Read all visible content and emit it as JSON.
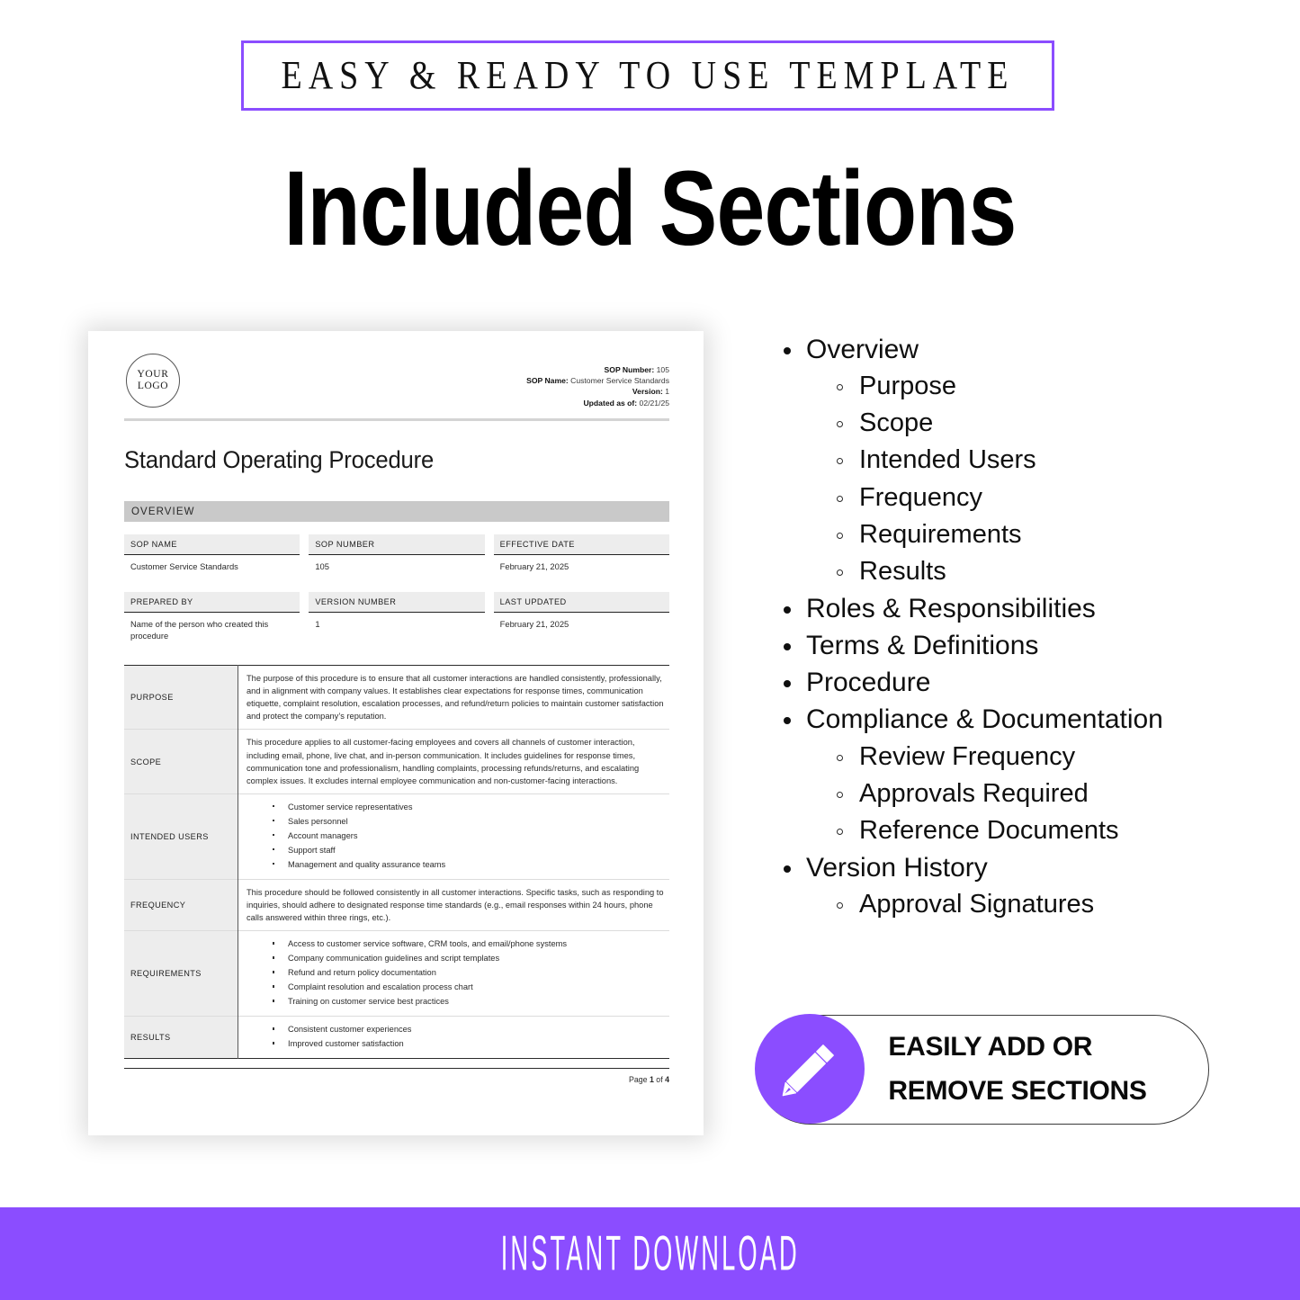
{
  "top_banner": {
    "text": "EASY & READY TO USE TEMPLATE"
  },
  "page_title": "Included Sections",
  "colors": {
    "accent_purple": "#8b4dff",
    "section_bar_gray": "#c9c9c9",
    "table_head_gray": "#ededed"
  },
  "document": {
    "logo": {
      "line1": "YOUR",
      "line2": "LOGO"
    },
    "meta": [
      {
        "label": "SOP Number:",
        "value": "105"
      },
      {
        "label": "SOP Name:",
        "value": "Customer Service Standards"
      },
      {
        "label": "Version:",
        "value": "1"
      },
      {
        "label": "Updated as of:",
        "value": "02/21/25"
      }
    ],
    "title": "Standard Operating Procedure",
    "section_bar": "OVERVIEW",
    "info_table_1": {
      "headers": [
        "SOP NAME",
        "SOP NUMBER",
        "EFFECTIVE DATE"
      ],
      "values": [
        "Customer Service Standards",
        "105",
        "February 21, 2025"
      ]
    },
    "info_table_2": {
      "headers": [
        "PREPARED BY",
        "VERSION NUMBER",
        "LAST UPDATED"
      ],
      "values": [
        "Name of the person who created this procedure",
        "1",
        "February 21, 2025"
      ]
    },
    "detail_rows": [
      {
        "label": "PURPOSE",
        "type": "paragraph",
        "text": "The purpose of this procedure is to ensure that all customer interactions are handled consistently, professionally, and in alignment with company values. It establishes clear expectations for response times, communication etiquette, complaint resolution, escalation processes, and refund/return policies to maintain customer satisfaction and protect the company’s reputation."
      },
      {
        "label": "SCOPE",
        "type": "paragraph",
        "text": "This procedure applies to all customer-facing employees and covers all channels of customer interaction, including email, phone, live chat, and in-person communication. It includes guidelines for response times, communication tone and professionalism, handling complaints, processing refunds/returns, and escalating complex issues. It excludes internal employee communication and non-customer-facing interactions."
      },
      {
        "label": "INTENDED USERS",
        "type": "list",
        "items": [
          "Customer service representatives",
          "Sales personnel",
          "Account managers",
          "Support staff",
          "Management and quality assurance teams"
        ]
      },
      {
        "label": "FREQUENCY",
        "type": "paragraph",
        "text": "This procedure should be followed consistently in all customer interactions. Specific tasks, such as responding to inquiries, should adhere to designated response time standards (e.g., email responses within 24 hours, phone calls answered within three rings, etc.)."
      },
      {
        "label": "REQUIREMENTS",
        "type": "list",
        "items": [
          "Access to customer service software, CRM tools, and email/phone systems",
          "Company communication guidelines and script templates",
          "Refund and return policy documentation",
          "Complaint resolution and escalation process chart",
          "Training on customer service best practices"
        ]
      },
      {
        "label": "RESULTS",
        "type": "list",
        "items": [
          "Consistent customer experiences",
          "Improved customer satisfaction"
        ]
      }
    ],
    "footer": {
      "prefix": "Page ",
      "current": "1",
      "middle": " of ",
      "total": "4"
    }
  },
  "sections_list": [
    {
      "level": 1,
      "label": "Overview"
    },
    {
      "level": 2,
      "label": "Purpose"
    },
    {
      "level": 2,
      "label": "Scope"
    },
    {
      "level": 2,
      "label": "Intended Users"
    },
    {
      "level": 2,
      "label": "Frequency"
    },
    {
      "level": 2,
      "label": "Requirements"
    },
    {
      "level": 2,
      "label": "Results"
    },
    {
      "level": 1,
      "label": "Roles & Responsibilities"
    },
    {
      "level": 1,
      "label": "Terms & Definitions"
    },
    {
      "level": 1,
      "label": "Procedure"
    },
    {
      "level": 1,
      "label": "Compliance & Documentation"
    },
    {
      "level": 2,
      "label": "Review Frequency"
    },
    {
      "level": 2,
      "label": "Approvals Required"
    },
    {
      "level": 2,
      "label": "Reference Documents"
    },
    {
      "level": 1,
      "label": "Version History"
    },
    {
      "level": 2,
      "label": "Approval Signatures"
    }
  ],
  "pill_badge": {
    "icon": "pencil-icon",
    "line1": "EASILY ADD OR",
    "line2": "REMOVE SECTIONS"
  },
  "bottom_banner": {
    "text": "INSTANT DOWNLOAD"
  }
}
